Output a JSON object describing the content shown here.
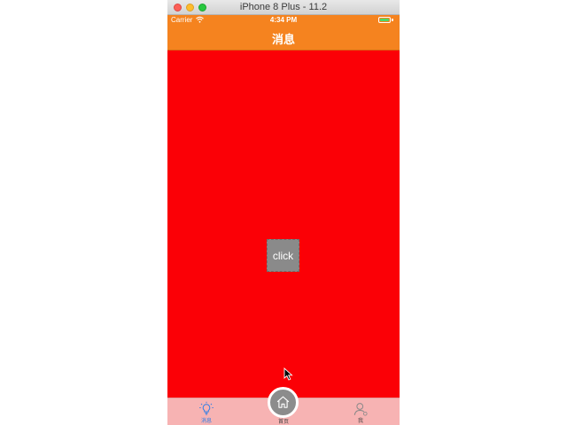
{
  "window": {
    "title": "iPhone 8 Plus - 11.2"
  },
  "statusbar": {
    "carrier": "Carrier",
    "time": "4:34 PM",
    "battery_icon": "battery-icon",
    "wifi_icon": "wifi-icon"
  },
  "navbar": {
    "title": "消息"
  },
  "content": {
    "background": "#fb0006",
    "click_label": "click"
  },
  "tabbar": {
    "items": [
      {
        "label": "消息",
        "icon": "lightbulb-icon",
        "selected": true
      },
      {
        "label": "首页",
        "icon": "home-icon",
        "selected": false
      },
      {
        "label": "我",
        "icon": "person-icon",
        "selected": false
      }
    ]
  },
  "colors": {
    "nav_orange": "#f5831f",
    "content_red": "#fb0006",
    "tabbar_pink": "#f7b3b3",
    "selected_blue": "#2f7ee6"
  }
}
